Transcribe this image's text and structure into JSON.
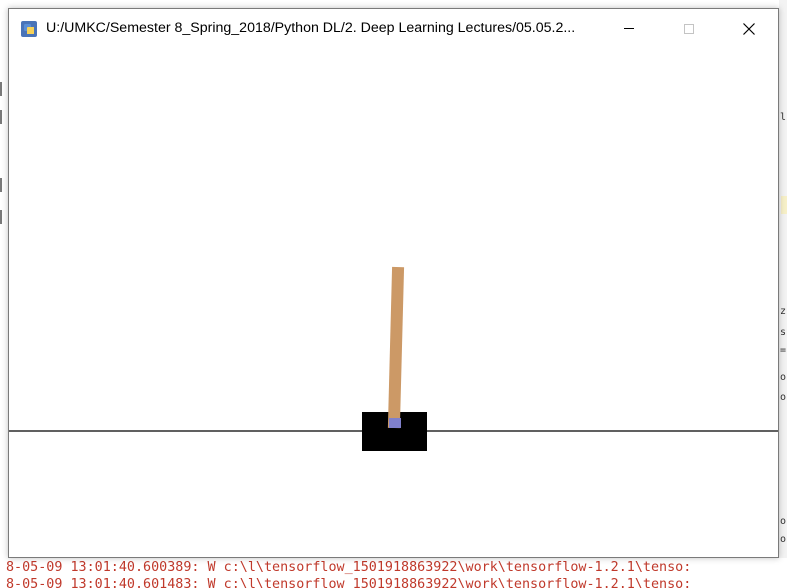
{
  "window": {
    "title": "U:/UMKC/Semester 8_Spring_2018/Python DL/2. Deep Learning Lectures/05.05.2...",
    "icon": "python-icon",
    "controls": [
      "minimize-icon",
      "maximize-icon",
      "close-icon"
    ]
  },
  "scene": {
    "track_color": "#000000",
    "cart_color": "#000000",
    "pole_color": "#cc9966",
    "axle_color": "#8080cc",
    "pole_angle_deg": 1.5
  },
  "background": {
    "right_edge_chars": [
      "l",
      "z",
      "s",
      "=",
      "o",
      "o",
      "o",
      "o"
    ],
    "console_lines": [
      "8-05-09 13:01:40.600389: W c:\\l\\tensorflow_1501918863922\\work\\tensorflow-1.2.1\\tenso:",
      "8-05-09 13:01:40.601483: W c:\\l\\tensorflow_1501918863922\\work\\tensorflow-1.2.1\\tenso:"
    ]
  }
}
